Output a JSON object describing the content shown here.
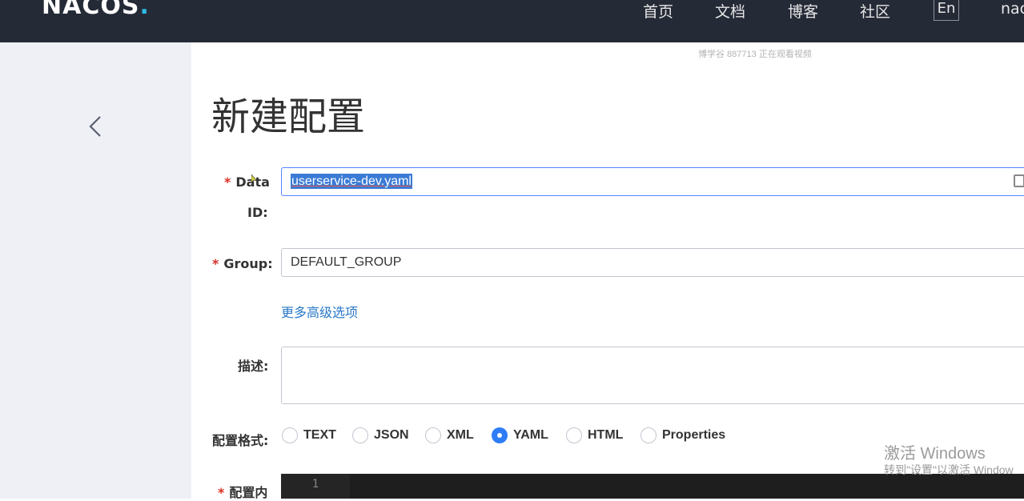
{
  "header": {
    "logo": "NACOS",
    "logo_dot": ".",
    "nav": [
      "首页",
      "文档",
      "博客",
      "社区"
    ],
    "lang": "En",
    "user": "nac"
  },
  "watermark": "博学谷 887713 正在观看视频",
  "page_title": "新建配置",
  "form": {
    "data_id": {
      "label_line1": "Data",
      "label_line2": "ID:",
      "value": "userservice-dev.yaml"
    },
    "group": {
      "label": "Group:",
      "value": "DEFAULT_GROUP"
    },
    "advanced_link": "更多高级选项",
    "desc_label": "描述:",
    "format_label": "配置格式:",
    "formats": [
      "TEXT",
      "JSON",
      "XML",
      "YAML",
      "HTML",
      "Properties"
    ],
    "selected_format": "YAML",
    "content_label": "配置内",
    "editor_line": "1"
  },
  "activate": {
    "title": "激活 Windows",
    "sub": "转到\"设置\"以激活 Window"
  },
  "colors": {
    "topbar": "#252a37",
    "accent": "#2e7cf6",
    "link": "#2878c8",
    "required": "#d93026"
  }
}
